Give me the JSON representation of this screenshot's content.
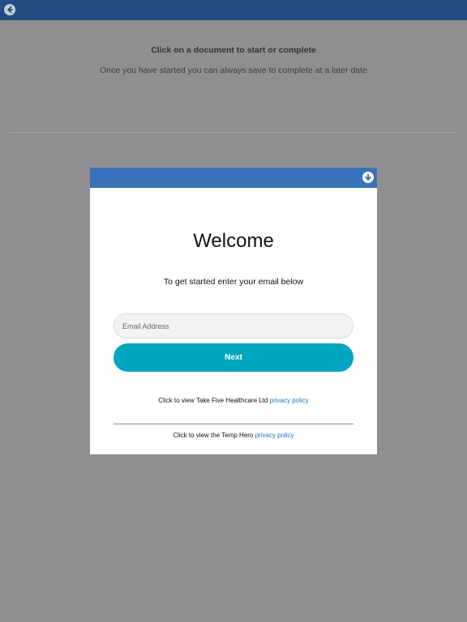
{
  "colors": {
    "page_background": "#8f8f91",
    "top_bar": "#224c82",
    "modal_header": "#3a73bb",
    "next_button": "#00a5c0",
    "link": "#1a73c9"
  },
  "topbar": {
    "back_icon": "arrow-left-circle"
  },
  "page": {
    "heading": "Click on a document to start or complete",
    "subheading": "Once you have started you can always save to complete at a later date"
  },
  "modal": {
    "header_icon": "arrow-down-circle",
    "title": "Welcome",
    "subtitle": "To get started enter your email below",
    "email_placeholder": "Email Address",
    "email_value": "",
    "next_label": "Next",
    "policy_1_text": "Click to view Take Five Healthcare Ltd",
    "policy_1_link": "privacy policy",
    "policy_2_text": "Click to view the Temp Hero",
    "policy_2_link": "privacy policy"
  }
}
